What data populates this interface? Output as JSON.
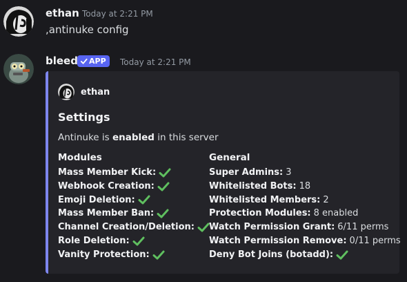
{
  "messages": [
    {
      "username": "ethan",
      "timestamp": "Today at 2:21 PM",
      "text": ",antinuke config"
    },
    {
      "username": "bleed",
      "badge": "APP",
      "badge_icon": "check-icon",
      "timestamp": "Today at 2:21 PM",
      "embed": {
        "accent": "#7e86ee",
        "author": "ethan",
        "title": "Settings",
        "description_prefix": "Antinuke is ",
        "description_bold": "enabled",
        "description_suffix": " in this server",
        "modules": {
          "title": "Modules",
          "items": [
            {
              "label": "Mass Member Kick:",
              "status_icon": "green-check-icon"
            },
            {
              "label": "Webhook Creation:",
              "status_icon": "green-check-icon"
            },
            {
              "label": "Emoji Deletion:",
              "status_icon": "green-check-icon"
            },
            {
              "label": "Mass Member Ban:",
              "status_icon": "green-check-icon"
            },
            {
              "label": "Channel Creation/Deletion:",
              "status_icon": "green-check-icon"
            },
            {
              "label": "Role Deletion:",
              "status_icon": "green-check-icon"
            },
            {
              "label": "Vanity Protection:",
              "status_icon": "green-check-icon"
            }
          ]
        },
        "general": {
          "title": "General",
          "items": [
            {
              "label": "Super Admins:",
              "value": "3"
            },
            {
              "label": "Whitelisted Bots:",
              "value": "18"
            },
            {
              "label": "Whitelisted Members:",
              "value": "2"
            },
            {
              "label": "Protection Modules:",
              "value": "8 enabled"
            },
            {
              "label": "Watch Permission Grant:",
              "value": "6/11 perms"
            },
            {
              "label": "Watch Permission Remove:",
              "value": "0/11 perms"
            },
            {
              "label": "Deny Bot Joins (botadd):",
              "status_icon": "green-check-icon"
            }
          ]
        }
      }
    }
  ],
  "colors": {
    "background": "#1a1a1e",
    "embed_background": "#242429",
    "app_badge": "#5865f2",
    "check_green": "#5fbf5f"
  }
}
